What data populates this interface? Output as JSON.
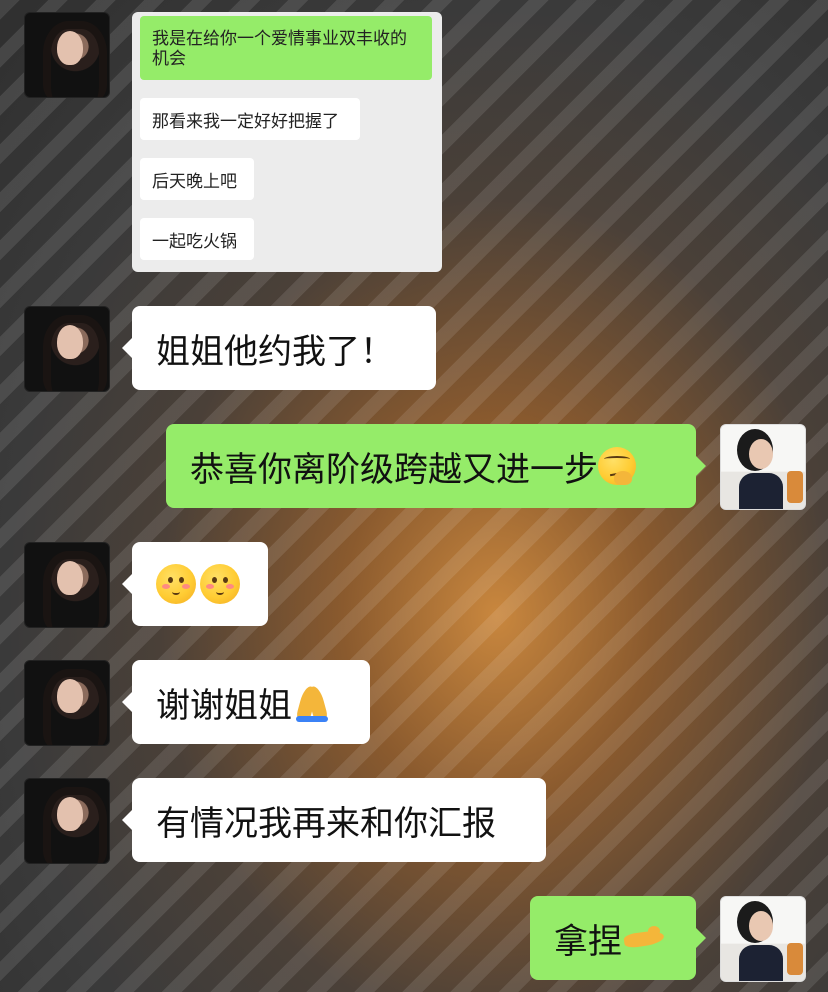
{
  "quote": {
    "lines": [
      {
        "text": "我是在给你一个爱情事业双丰收的机会",
        "style": "green"
      },
      {
        "text": "那看来我一定好好把握了",
        "style": "white"
      },
      {
        "text": "后天晚上吧",
        "style": "white"
      },
      {
        "text": "一起吃火锅",
        "style": "white"
      }
    ]
  },
  "messages": [
    {
      "sender": "contact",
      "text": "姐姐他约我了！"
    },
    {
      "sender": "self",
      "text": "恭喜你离阶级跨越又进一步",
      "emoji": "smirk-face-icon"
    },
    {
      "sender": "contact",
      "text": "",
      "emoji": "smiling-face-icon"
    },
    {
      "sender": "contact",
      "text": "谢谢姐姐",
      "emoji": "praying-hands-icon"
    },
    {
      "sender": "contact",
      "text": "有情况我再来和你汇报"
    },
    {
      "sender": "self",
      "text": "拿捏",
      "emoji": "pinching-hand-icon"
    }
  ],
  "colors": {
    "bubble_self": "#95ec69",
    "bubble_contact": "#ffffff"
  }
}
